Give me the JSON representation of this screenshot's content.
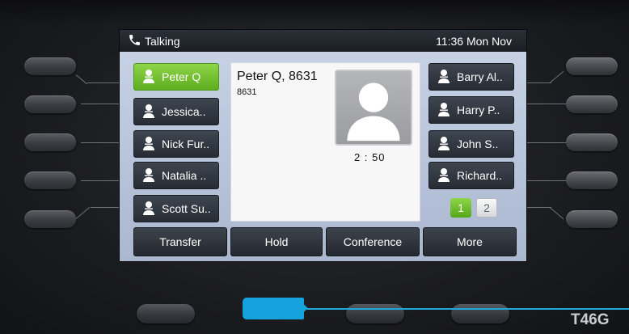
{
  "status_bar": {
    "state": "Talking",
    "time": "11:36 Mon Nov",
    "state_icon": "phone-handset-icon"
  },
  "left_keys": [
    {
      "label": "Peter Q",
      "active": true
    },
    {
      "label": "Jessica..",
      "active": false
    },
    {
      "label": "Nick Fur..",
      "active": false
    },
    {
      "label": "Natalia ..",
      "active": false
    },
    {
      "label": "Scott Su..",
      "active": false
    }
  ],
  "right_keys": [
    {
      "label": "Barry Al.."
    },
    {
      "label": "Harry P.."
    },
    {
      "label": "John S.."
    },
    {
      "label": "Richard.."
    }
  ],
  "call": {
    "name": "Peter Q, 8631",
    "number": "8631",
    "duration": "2 : 50",
    "avatar_icon": "contact-avatar-icon"
  },
  "pages": {
    "current": "1",
    "next": "2"
  },
  "softkeys": [
    "Transfer",
    "Hold",
    "Conference",
    "More"
  ],
  "device": {
    "model": "T46G"
  },
  "colors": {
    "active_green": "#6cc12c",
    "pointer_blue": "#16a2dd",
    "screen_bg": "#c2cde0"
  },
  "icons": {
    "contact": "contact-person-icon"
  }
}
